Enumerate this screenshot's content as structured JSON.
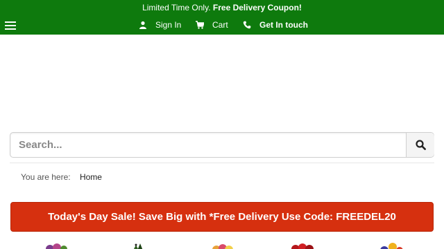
{
  "header": {
    "promo_text": "Limited Time Only.",
    "promo_bold": "Free Delivery Coupon!",
    "nav": {
      "sign_in": "Sign In",
      "cart": "Cart",
      "contact": "Get In touch"
    },
    "icons": [
      "menu-icon",
      "user-icon",
      "cart-icon",
      "phone-icon"
    ]
  },
  "search": {
    "placeholder": "Search...",
    "value": "",
    "button_icon": "search-icon"
  },
  "breadcrumb": {
    "prefix": "You are here:",
    "home": "Home"
  },
  "banner": {
    "text": "Today's Day Sale! Save Big with *Free Delivery Use Code: FREEDEL20"
  },
  "colors": {
    "header_bg": "#0e7a0d",
    "banner_bg": "#d6300f"
  }
}
